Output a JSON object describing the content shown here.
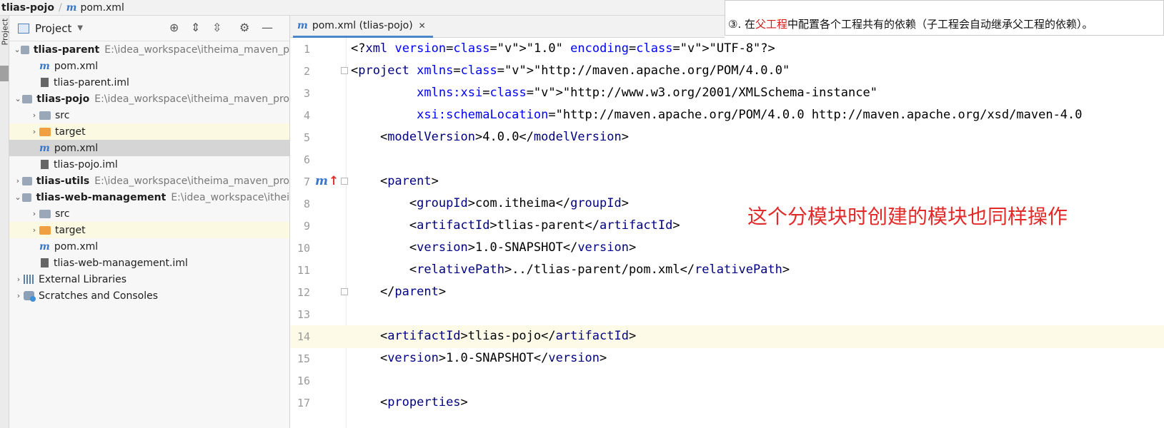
{
  "breadcrumb": {
    "project": "tlias-pojo",
    "file": "pom.xml"
  },
  "strip": {
    "label": "Project"
  },
  "panel": {
    "title": "Project"
  },
  "tree": [
    {
      "label": "tlias-parent",
      "path": "E:\\idea_workspace\\itheima_maven_p",
      "type": "module",
      "level": 0,
      "expanded": true
    },
    {
      "label": "pom.xml",
      "type": "pom",
      "level": 1
    },
    {
      "label": "tlias-parent.iml",
      "type": "iml",
      "level": 1
    },
    {
      "label": "tlias-pojo",
      "path": "E:\\idea_workspace\\itheima_maven_pro",
      "type": "module",
      "level": 0,
      "expanded": true
    },
    {
      "label": "src",
      "type": "src",
      "level": 1
    },
    {
      "label": "target",
      "type": "target",
      "level": 1
    },
    {
      "label": "pom.xml",
      "type": "pom",
      "level": 1,
      "selected": true
    },
    {
      "label": "tlias-pojo.iml",
      "type": "iml",
      "level": 1
    },
    {
      "label": "tlias-utils",
      "path": "E:\\idea_workspace\\itheima_maven_pro",
      "type": "module",
      "level": 0,
      "expanded": false
    },
    {
      "label": "tlias-web-management",
      "path": "E:\\idea_workspace\\ithei",
      "type": "module",
      "level": 0,
      "expanded": true
    },
    {
      "label": "src",
      "type": "src",
      "level": 1
    },
    {
      "label": "target",
      "type": "target",
      "level": 1
    },
    {
      "label": "pom.xml",
      "type": "pom",
      "level": 1
    },
    {
      "label": "tlias-web-management.iml",
      "type": "iml",
      "level": 1
    },
    {
      "label": "External Libraries",
      "type": "lib",
      "level": 0,
      "expanded": false
    },
    {
      "label": "Scratches and Consoles",
      "type": "scratch",
      "level": 0,
      "expanded": false
    }
  ],
  "tab": {
    "label": "pom.xml (tlias-pojo)"
  },
  "banner": {
    "prefix": "③. 在",
    "highlight": "父工程",
    "suffix": "中配置各个工程共有的依赖（子工程会自动继承父工程的依赖）。"
  },
  "annotation": "这个分模块时创建的模块也同样操作",
  "editor": {
    "lines": [
      {
        "n": "1",
        "code": "<?xml version=\"1.0\" encoding=\"UTF-8\"?>"
      },
      {
        "n": "2",
        "code": "<project xmlns=\"http://maven.apache.org/POM/4.0.0\""
      },
      {
        "n": "3",
        "code": "         xmlns:xsi=\"http://www.w3.org/2001/XMLSchema-instance\""
      },
      {
        "n": "4",
        "code": "         xsi:schemaLocation=\"http://maven.apache.org/POM/4.0.0 http://maven.apache.org/xsd/maven-4.0"
      },
      {
        "n": "5",
        "code": "    <modelVersion>4.0.0</modelVersion>"
      },
      {
        "n": "6",
        "code": ""
      },
      {
        "n": "7",
        "code": "    <parent>"
      },
      {
        "n": "8",
        "code": "        <groupId>com.itheima</groupId>"
      },
      {
        "n": "9",
        "code": "        <artifactId>tlias-parent</artifactId>"
      },
      {
        "n": "10",
        "code": "        <version>1.0-SNAPSHOT</version>"
      },
      {
        "n": "11",
        "code": "        <relativePath>../tlias-parent/pom.xml</relativePath>"
      },
      {
        "n": "12",
        "code": "    </parent>"
      },
      {
        "n": "13",
        "code": ""
      },
      {
        "n": "14",
        "code": "    <artifactId>tlias-pojo</artifactId>"
      },
      {
        "n": "15",
        "code": "    <version>1.0-SNAPSHOT</version>"
      },
      {
        "n": "16",
        "code": ""
      },
      {
        "n": "17",
        "code": "    <properties>"
      }
    ]
  },
  "colors": {
    "tag": "#000080",
    "attr": "#0000ff",
    "value": "#067d17",
    "annotation": "#e32a2a",
    "accent": "#4a86c8"
  }
}
